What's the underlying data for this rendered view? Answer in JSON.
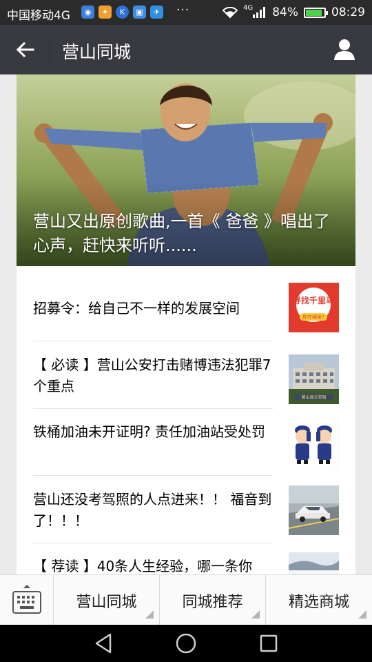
{
  "status": {
    "carrier": "中国移动4G",
    "network": "4G",
    "battery": "84%",
    "time": "08:29",
    "more": "···"
  },
  "header": {
    "title": "营山同城"
  },
  "hero": {
    "title": "营山又出原创歌曲,一首《 爸爸 》唱出了心声，赶快来听听......"
  },
  "news": [
    {
      "title": "招募令：给自己不一样的发展空间",
      "thumb_text": "寻找千里马",
      "thumb_sub": "你在哪里?"
    },
    {
      "title": "【 必读 】营山公安打击赌博违法犯罪7个重点",
      "thumb_text": "营山县公安局"
    },
    {
      "title": "铁桶加油未开证明? 责任加油站受处罚"
    },
    {
      "title": "营山还没考驾照的人点进来！！ 福音到了！！！"
    },
    {
      "title": "【 荐读 】40条人生经验，哪一条你"
    }
  ],
  "menu": {
    "tabs": [
      "营山同城",
      "同城推荐",
      "精选商城"
    ]
  }
}
